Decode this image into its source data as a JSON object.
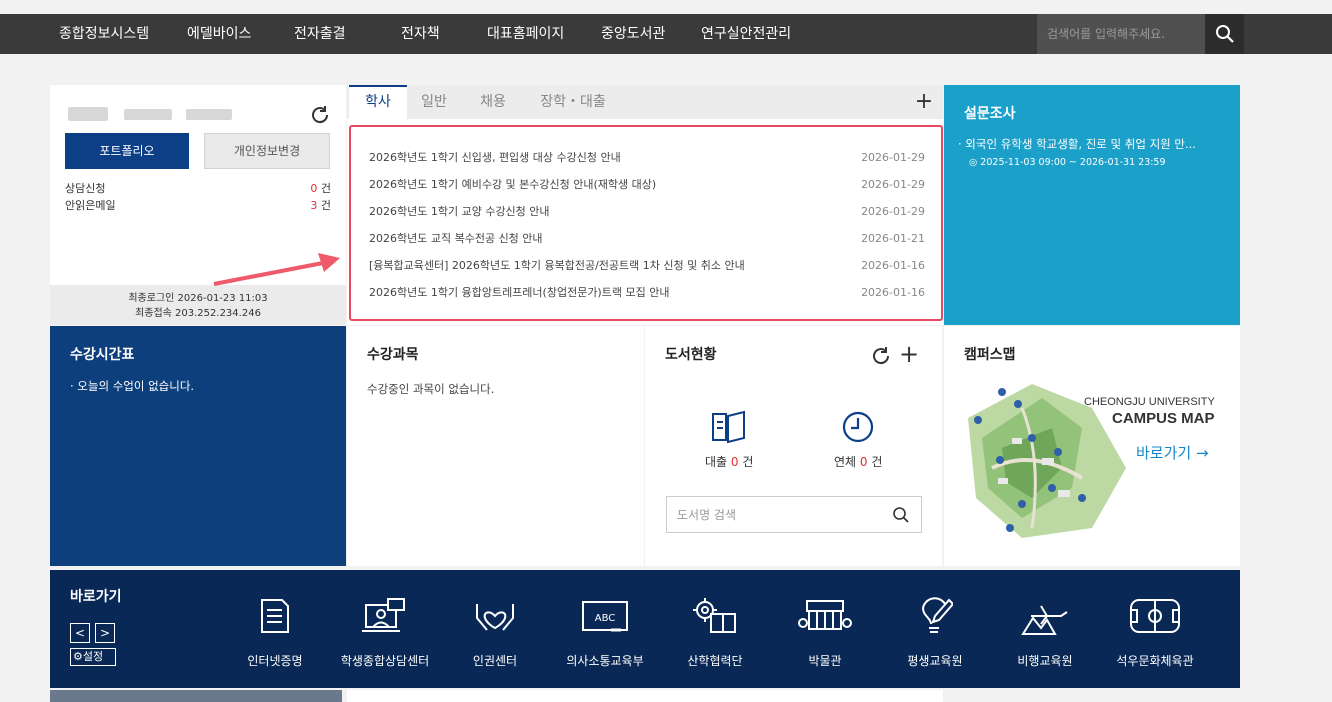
{
  "nav": {
    "items": [
      "종합정보시스템",
      "에델바이스",
      "전자출결",
      "전자책",
      "대표홈페이지",
      "중앙도서관",
      "연구실안전관리"
    ],
    "search_placeholder": "검색어를 입력해주세요."
  },
  "user": {
    "portfolio_label": "포트폴리오",
    "profile_change_label": "개인정보변경",
    "counseling_label": "상담신청",
    "counseling_count": "0",
    "unread_mail_label": "안읽은메일",
    "unread_mail_count": "3",
    "count_unit": "건",
    "last_login": "최종로그인 2026-01-23 11:03",
    "last_ip": "최종접속 203.252.234.246"
  },
  "notice": {
    "tabs": [
      "학사",
      "일반",
      "채용",
      "장학・대출"
    ],
    "add_symbol": "+",
    "items": [
      {
        "title": "2026학년도 1학기 신입생, 편입생 대상 수강신청 안내",
        "date": "2026-01-29"
      },
      {
        "title": "2026학년도 1학기 예비수강 및 본수강신청 안내(재학생 대상)",
        "date": "2026-01-29"
      },
      {
        "title": "2026학년도 1학기 교양 수강신청 안내",
        "date": "2026-01-29"
      },
      {
        "title": "2026학년도 교직 복수전공 신청 안내",
        "date": "2026-01-21"
      },
      {
        "title": "[융복합교육센터] 2026학년도 1학기 융복합전공/전공트랙 1차 신청 및 취소 안내",
        "date": "2026-01-16"
      },
      {
        "title": "2026학년도 1학기 융합앙트레프레너(창업전문가)트랙 모집 안내",
        "date": "2026-01-16"
      }
    ]
  },
  "survey": {
    "title": "설문조사",
    "item_title": "· 외국인 유학생 학교생활, 진로 및 취업 지원 만...",
    "item_period": "◎ 2025-11-03 09:00 ~ 2026-01-31 23:59"
  },
  "timetable": {
    "title": "수강시간표",
    "empty": "· 오늘의 수업이 없습니다."
  },
  "courses": {
    "title": "수강과목",
    "empty": "수강중인 과목이 없습니다."
  },
  "library": {
    "title": "도서현황",
    "add_symbol": "+",
    "loan_label": "대출",
    "loan_count": "0",
    "overdue_label": "연체",
    "overdue_count": "0",
    "count_unit": "건",
    "search_placeholder": "도서명 검색"
  },
  "campus": {
    "title": "캠퍼스맵",
    "map_title_1": "CHEONGJU UNIVERSITY",
    "map_title_2": "CAMPUS MAP",
    "go_label": "바로가기 →"
  },
  "quicklinks": {
    "title": "바로가기",
    "prev": "<",
    "next": ">",
    "settings_label": "설정",
    "items": [
      {
        "label": "인터넷증명",
        "icon": "document-icon"
      },
      {
        "label": "학생종합상담센터",
        "icon": "counseling-icon"
      },
      {
        "label": "인권센터",
        "icon": "hands-heart-icon"
      },
      {
        "label": "의사소통교육부",
        "icon": "blackboard-icon"
      },
      {
        "label": "산학협력단",
        "icon": "gear-book-icon"
      },
      {
        "label": "박물관",
        "icon": "museum-icon"
      },
      {
        "label": "평생교육원",
        "icon": "lightbulb-pen-icon"
      },
      {
        "label": "비행교육원",
        "icon": "airplane-icon"
      },
      {
        "label": "석우문화체육관",
        "icon": "stadium-icon"
      }
    ]
  },
  "colors": {
    "navy": "#0d3f87",
    "sky": "#1aa0c9",
    "alert_red": "#e03030",
    "highlight_red": "#e84a5f"
  }
}
